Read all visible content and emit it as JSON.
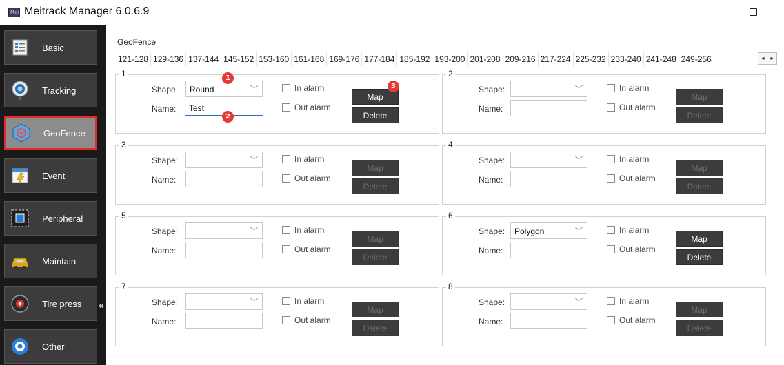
{
  "window": {
    "title": "Meitrack Manager 6.0.6.9",
    "icon_text": "Mei"
  },
  "sidebar": {
    "items": [
      {
        "label": "Basic",
        "icon": "basic-icon",
        "active": false
      },
      {
        "label": "Tracking",
        "icon": "tracking-icon",
        "active": false
      },
      {
        "label": "GeoFence",
        "icon": "geofence-icon",
        "active": true
      },
      {
        "label": "Event",
        "icon": "event-icon",
        "active": false
      },
      {
        "label": "Peripheral",
        "icon": "peripheral-icon",
        "active": false
      },
      {
        "label": "Maintain",
        "icon": "maintain-icon",
        "active": false
      },
      {
        "label": "Tire press",
        "icon": "tire-press-icon",
        "active": false
      },
      {
        "label": "Other",
        "icon": "other-icon",
        "active": false
      }
    ],
    "collapse_glyph": "«"
  },
  "geofence": {
    "section_label": "GeoFence",
    "range_tabs": [
      "121-128",
      "129-136",
      "137-144",
      "145-152",
      "153-160",
      "161-168",
      "169-176",
      "177-184",
      "185-192",
      "193-200",
      "201-208",
      "209-216",
      "217-224",
      "225-232",
      "233-240",
      "241-248",
      "249-256"
    ],
    "scroll_left": "◂",
    "scroll_right": "▸",
    "labels": {
      "shape": "Shape:",
      "name": "Name:",
      "in_alarm": "In alarm",
      "out_alarm": "Out alarm",
      "map": "Map",
      "delete": "Delete"
    },
    "fences": [
      {
        "number": "1",
        "shape": "Round",
        "name": "Test",
        "buttons_enabled": true
      },
      {
        "number": "2",
        "shape": "",
        "name": "",
        "buttons_enabled": false
      },
      {
        "number": "3",
        "shape": "",
        "name": "",
        "buttons_enabled": false
      },
      {
        "number": "4",
        "shape": "",
        "name": "",
        "buttons_enabled": false
      },
      {
        "number": "5",
        "shape": "",
        "name": "",
        "buttons_enabled": false
      },
      {
        "number": "6",
        "shape": "Polygon",
        "name": "",
        "buttons_enabled": true
      },
      {
        "number": "7",
        "shape": "",
        "name": "",
        "buttons_enabled": false
      },
      {
        "number": "8",
        "shape": "",
        "name": "",
        "buttons_enabled": false
      }
    ]
  },
  "annotations": [
    "1",
    "2",
    "3"
  ],
  "colors": {
    "sidebar_bg": "#1a1a1a",
    "active_border": "#e42a2a",
    "badge": "#e53a36",
    "button_bg": "#3c3c3c"
  }
}
